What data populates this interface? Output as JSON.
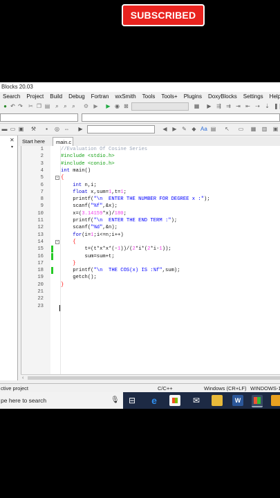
{
  "overlay": {
    "subscribed_label": "SUBSCRIBED"
  },
  "window": {
    "title": "Blocks 20.03"
  },
  "menu": [
    "Search",
    "Project",
    "Build",
    "Debug",
    "Fortran",
    "wxSmith",
    "Tools",
    "Tools+",
    "Plugins",
    "DoxyBlocks",
    "Settings",
    "Help"
  ],
  "tabs": {
    "start": "Start here",
    "file": "main.c"
  },
  "code_lines": [
    {
      "n": "1",
      "html": "<span class='comment'>//Evaluation Of Cosine Series</span>"
    },
    {
      "n": "2",
      "html": "<span class='pp'>#include &lt;stdio.h&gt;</span>"
    },
    {
      "n": "3",
      "html": "<span class='pp'>#include &lt;conio.h&gt;</span>"
    },
    {
      "n": "4",
      "html": "<span class='kw'>int</span> main()"
    },
    {
      "n": "5",
      "html": "<span class='op'>{</span>"
    },
    {
      "n": "6",
      "html": "    <span class='kw'>int</span> n,i;"
    },
    {
      "n": "7",
      "html": "    <span class='kw'>float</span> x,sum=<span class='num'>1</span>,t=<span class='num'>1</span>;"
    },
    {
      "n": "8",
      "html": "    printf(<span class='str'>\"\\n  ENTER THE NUMBER FOR DEGREE x :\"</span>);"
    },
    {
      "n": "9",
      "html": "    scanf(<span class='str'>\"%f\"</span>,&amp;x);"
    },
    {
      "n": "10",
      "html": "    x=(<span class='num'>3.14159</span>*x)/<span class='num'>180</span>;"
    },
    {
      "n": "11",
      "html": "    printf(<span class='str'>\"\\n  ENTER THE END TERM :\"</span>);"
    },
    {
      "n": "12",
      "html": "    scanf(<span class='str'>\"%d\"</span>,&amp;n);"
    },
    {
      "n": "13",
      "html": "    <span class='kw'>for</span>(i=<span class='num'>1</span>;i&lt;=n;i++)"
    },
    {
      "n": "14",
      "html": "    <span class='op'>{</span>"
    },
    {
      "n": "15",
      "html": "        t=(t*x*x*(-<span class='num'>1</span>))/(<span class='num'>2</span>*i*(<span class='num'>2</span>*i-<span class='num'>1</span>));"
    },
    {
      "n": "16",
      "html": "        sum=sum+t;"
    },
    {
      "n": "17",
      "html": "    <span class='op'>}</span>"
    },
    {
      "n": "18",
      "html": "    printf(<span class='str'>\"\\n  THE COS(x) IS :%f\"</span>,sum);"
    },
    {
      "n": "19",
      "html": "    getch();"
    },
    {
      "n": "20",
      "html": "<span class='op'>}</span>"
    },
    {
      "n": "21",
      "html": ""
    },
    {
      "n": "22",
      "html": ""
    },
    {
      "n": "23",
      "html": ""
    }
  ],
  "status": {
    "project": "ctive project",
    "lang": "C/C++",
    "eol": "Windows (CR+LF)",
    "encoding": "WINDOWS-1"
  },
  "taskbar": {
    "search_placeholder": "pe here to search"
  }
}
